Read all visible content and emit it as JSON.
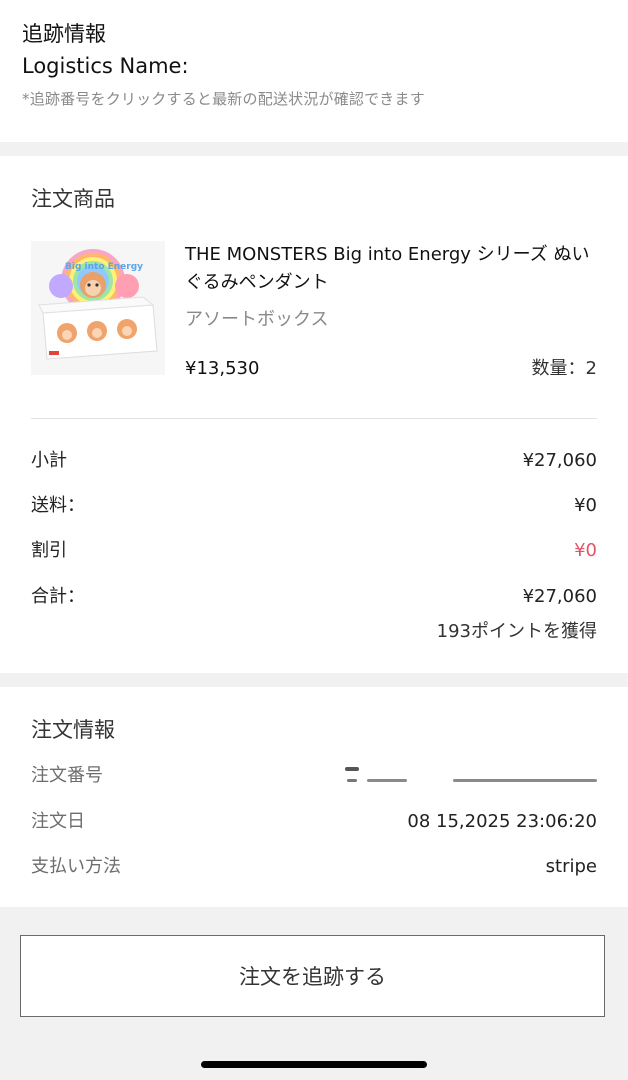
{
  "tracking": {
    "title": "追跡情報",
    "logistics_label": "Logistics Name:",
    "note": "*追跡番号をクリックすると最新の配送状況が確認できます"
  },
  "products": {
    "section_title": "注文商品",
    "item": {
      "name": "THE MONSTERS Big into Energy シリーズ ぬいぐるみペンダント",
      "variant": "アソートボックス",
      "price": "¥13,530",
      "quantity": "数量：2",
      "thumbnail_alt_text": "Big into Energy"
    },
    "summary": {
      "subtotal_label": "小計",
      "subtotal_value": "¥27,060",
      "shipping_label": "送料：",
      "shipping_value": "¥0",
      "discount_label": "割引",
      "discount_value": "¥0",
      "total_label": "合計：",
      "total_value": "¥27,060",
      "points": "193ポイントを獲得"
    }
  },
  "order_info": {
    "section_title": "注文情報",
    "order_number_label": "注文番号",
    "order_date_label": "注文日",
    "order_date_value": "08 15,2025 23:06:20",
    "payment_label": "支払い方法",
    "payment_value": "stripe"
  },
  "actions": {
    "track_button": "注文を追跡する"
  },
  "colors": {
    "discount_red": "#e0556a",
    "page_gray": "#f1f1f1",
    "text_dark": "#111111",
    "text_muted": "#8a8a8a"
  }
}
